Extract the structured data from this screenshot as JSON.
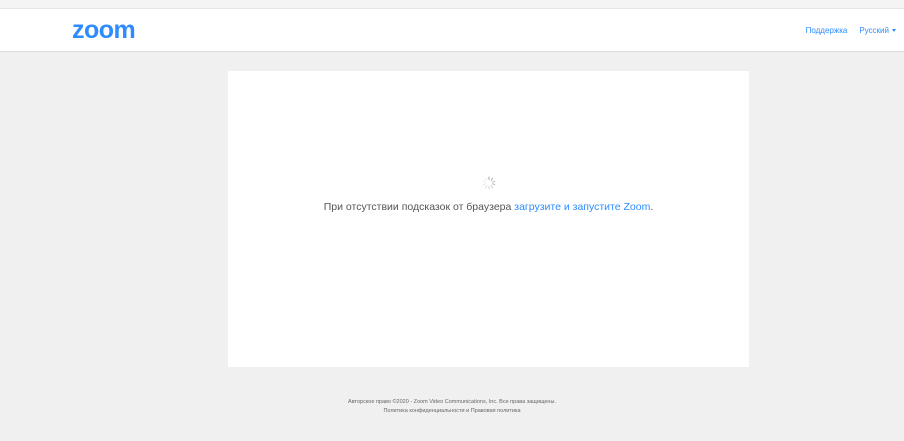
{
  "header": {
    "logo_text": "zoom",
    "nav": {
      "support_label": "Поддержка",
      "language_label": "Русский"
    }
  },
  "main": {
    "message_prefix": "При отсутствии подсказок от браузера ",
    "message_link": "загрузите и запустите Zoom",
    "message_suffix": "."
  },
  "footer": {
    "copyright": "Авторское право ©2020 - Zoom Video Communications, Inc. Все права защищены.",
    "privacy_link": "Политика конфиденциальности",
    "and_text": " и ",
    "legal_link": "Правовая политика"
  },
  "colors": {
    "accent": "#2d8cff",
    "background": "#f0f0f0",
    "card": "#ffffff"
  }
}
